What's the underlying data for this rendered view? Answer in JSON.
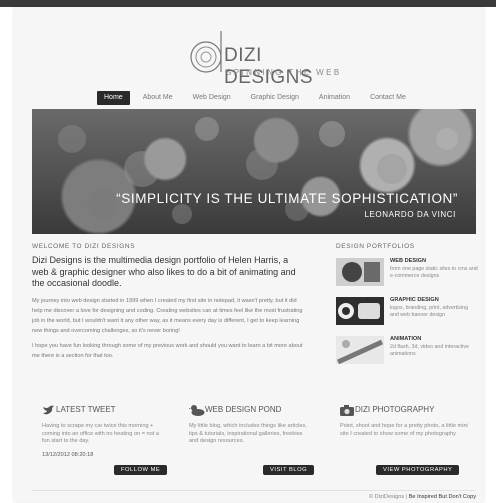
{
  "brand": {
    "name": "DIZI DESIGNS",
    "tagline": "SPINNING THE WEB"
  },
  "nav": {
    "items": [
      "Home",
      "About Me",
      "Web Design",
      "Graphic Design",
      "Animation",
      "Contact Me"
    ],
    "active_index": 0
  },
  "hero": {
    "quote": "“SIMPLICITY IS THE ULTIMATE SOPHISTICATION”",
    "author": "LEONARDO DA VINCI"
  },
  "welcome": {
    "heading": "WELCOME TO DIZI DESIGNS",
    "lead": "Dizi Designs is the multimedia design portfolio of Helen Harris, a web & graphic designer who also likes to do a bit of animating and the occasional doodle.",
    "body_1": "My journey into web design started in 1999 when I created my first site in notepad, it wasn't pretty, but it did help me discover a love for designing and coding. Creating websites can at times feel like the most frustrating job in the world, but I wouldn't want it any other way, as it means every day is different, I get to keep learning new things and overcoming challenges, so it's never boring!",
    "body_2": "I hope you have fun looking through some of my previous work and should you want to learn a bit more about me there is a section for that too."
  },
  "portfolios": {
    "heading": "DESIGN PORTFOLIOS",
    "items": [
      {
        "title": "WEB DESIGN",
        "desc": "from one page static sites to cms and e-commerce designs"
      },
      {
        "title": "GRAPHIC DESIGN",
        "desc": "logos, branding, print, advertising and web banner design"
      },
      {
        "title": "ANIMATION",
        "desc": "2d flash, 3d, video and interactive animations"
      }
    ]
  },
  "columns": {
    "tweet": {
      "title": "LATEST TWEET",
      "text": "Having to scrape my car twice this morning + coming into an office with no heating on = not a fun start to the day.",
      "date": "13/12/2012 08:20:18",
      "button": "FOLLOW ME"
    },
    "pond": {
      "title": "WEB DESIGN POND",
      "text": "My little blog, which includes things like articles, tips & tutorials, inspirational galleries, freebies and design resources.",
      "button": "VISIT BLOG"
    },
    "photo": {
      "title": "DIZI PHOTOGRAPHY",
      "text": "Point, shoot and hope for a pretty photo, a little mini site I created to show some of my photography",
      "button": "VIEW PHOTOGRAPHY"
    }
  },
  "footer": {
    "copyright": "© DiziDesigns |",
    "slogan": "Be Inspired But Don't Copy"
  },
  "colors": {
    "dark": "#2a2a2a",
    "page_bg": "#f6f6f6",
    "text": "#555555"
  }
}
